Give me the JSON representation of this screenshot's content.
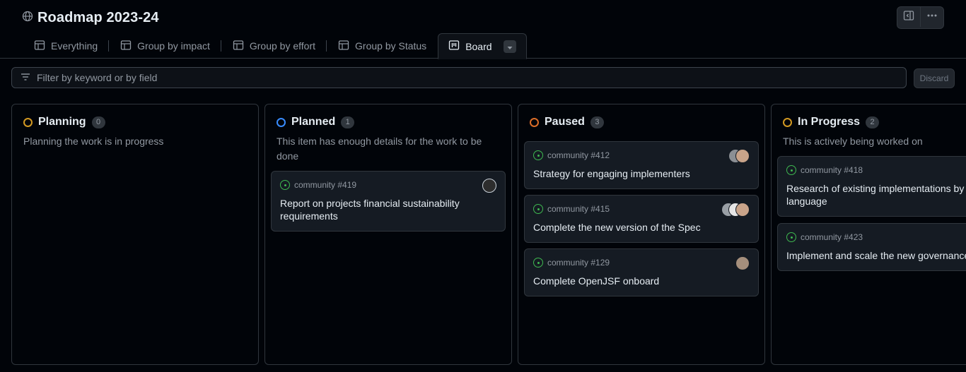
{
  "project": {
    "title": "Roadmap 2023-24",
    "icon": "globe-icon"
  },
  "tabs": [
    {
      "label": "Everything",
      "icon": "table-icon"
    },
    {
      "label": "Group by impact",
      "icon": "table-icon"
    },
    {
      "label": "Group by effort",
      "icon": "table-icon"
    },
    {
      "label": "Group by Status",
      "icon": "table-icon"
    },
    {
      "label": "Board",
      "icon": "board-icon",
      "active": true
    }
  ],
  "filter": {
    "placeholder": "Filter by keyword or by field",
    "discard_label": "Discard"
  },
  "columns": [
    {
      "name": "Planning",
      "count": "0",
      "ring_color": "#d29922",
      "description": "Planning the work is in progress",
      "cards": []
    },
    {
      "name": "Planned",
      "count": "1",
      "ring_color": "#388bfd",
      "description": "This item has enough details for the work to be done",
      "cards": [
        {
          "ref": "community #419",
          "title": "Report on projects financial sustainability requirements",
          "avatars": [
            "#2d2d2d"
          ]
        }
      ]
    },
    {
      "name": "Paused",
      "count": "3",
      "ring_color": "#db6d28",
      "description": "",
      "cards": [
        {
          "ref": "community #412",
          "title": "Strategy for engaging implementers",
          "avatars": [
            "#8b8f94",
            "#c9a48a"
          ]
        },
        {
          "ref": "community #415",
          "title": "Complete the new version of the Spec",
          "avatars": [
            "#9aa0a6",
            "#e6e6e6",
            "#c9a48a"
          ]
        },
        {
          "ref": "community #129",
          "title": "Complete OpenJSF onboard",
          "avatars": [
            "#a58f7c"
          ]
        }
      ]
    },
    {
      "name": "In Progress",
      "count": "2",
      "ring_color": "#d29922",
      "description": "This is actively being worked on",
      "cards": [
        {
          "ref": "community #418",
          "title": "Research of existing implementations by language",
          "avatars": []
        },
        {
          "ref": "community #423",
          "title": "Implement and scale the new governance",
          "avatars": []
        }
      ]
    }
  ]
}
